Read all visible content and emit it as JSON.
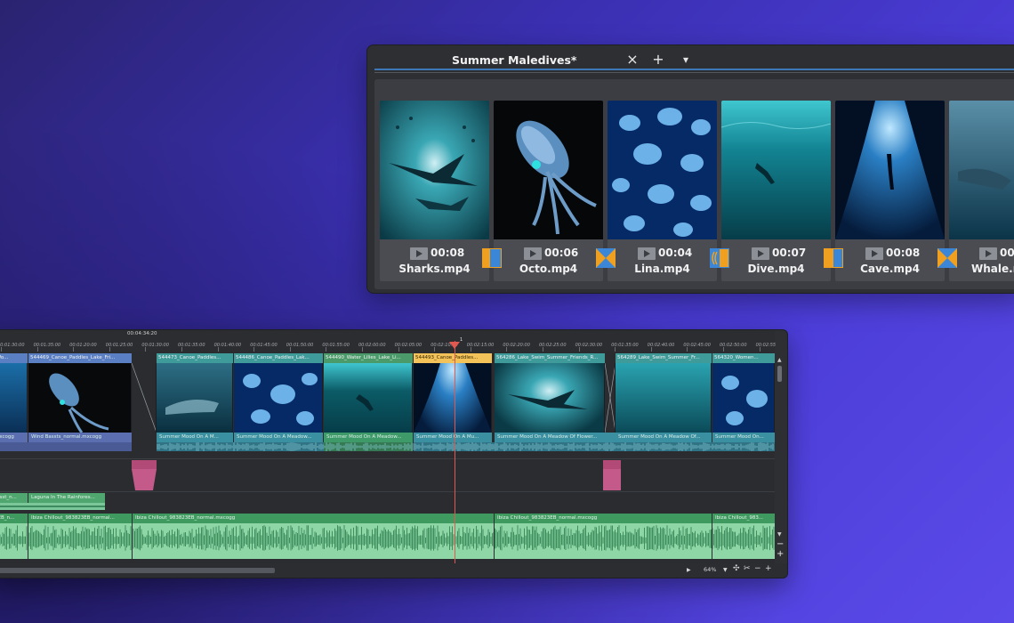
{
  "project": {
    "tab_title": "Summer Maledives*"
  },
  "bin_toolbar": {
    "close_icon": "×",
    "add_icon": "+",
    "menu_icon": "▾"
  },
  "bin_clips": [
    {
      "duration": "00:08",
      "name": "Sharks.mp4"
    },
    {
      "duration": "00:06",
      "name": "Octo.mp4"
    },
    {
      "duration": "00:04",
      "name": "Lina.mp4"
    },
    {
      "duration": "00:07",
      "name": "Dive.mp4"
    },
    {
      "duration": "00:08",
      "name": "Cave.mp4"
    },
    {
      "duration": "00",
      "name": "Whale.m"
    }
  ],
  "timeline": {
    "timecode_top": "00:04:34:20",
    "ruler_labels": [
      "00:01:30:00",
      "00:01:35:00",
      "00:01:20:00",
      "00:01:25:00",
      "00:01:30:00",
      "00:01:35:00",
      "00:01:40:00",
      "00:01:45:00",
      "00:01:50:00",
      "00:01:55:00",
      "00:02:00:00",
      "00:02:05:00",
      "00:02:10:00",
      "00:02:15:00",
      "00:02:20:00",
      "00:02:25:00",
      "00:02:30:00",
      "00:01:35:00",
      "00:02:40:00",
      "00:02:45:00",
      "00:02:50:00",
      "00:02:55"
    ],
    "video_clips": [
      {
        "title": "_Wo..."
      },
      {
        "title": "544469_Canoe_Paddles_Lake_Fri..."
      },
      {
        "title": "544473_Canoe_Paddles..."
      },
      {
        "title": "544486_Canoe_Paddles_Lak..."
      },
      {
        "title": "544490_Water_Lilies_Lake_Li..."
      },
      {
        "title": "544493_Canoe_Paddles..."
      },
      {
        "title": "564286_Lake_Swim_Summer_Friends_R..."
      },
      {
        "title": "564289_Lake_Swim_Summer_Fr..."
      },
      {
        "title": "564320_Women..."
      }
    ],
    "audio_clips": [
      {
        "label": "mxcogg"
      },
      {
        "label": "Wind Bassts_normal.mxcogg"
      },
      {
        "label": "Summer Mood On A M..."
      },
      {
        "label": "Summer Mood On A Meadow..."
      },
      {
        "label": "Summer Mood On A Meadow..."
      },
      {
        "label": "Summer Mood On A Mu..."
      },
      {
        "label": "Summer Mood On A Meadow Of Flower..."
      },
      {
        "label": "Summer Mood On A Meadow Of..."
      },
      {
        "label": "Summer Mood On..."
      }
    ],
    "music_short": [
      {
        "label": "resst_n..."
      },
      {
        "label": "Laguna In The Rainfores..."
      }
    ],
    "music_long": [
      {
        "label": "3EB_n..."
      },
      {
        "label": "Ibiza Chillout_983823EB_normal..."
      },
      {
        "label": "Ibiza Chillout_983823EB_normal.mxcogg"
      },
      {
        "label": "Ibiza Chillout_983823EB_normal.mxcogg"
      },
      {
        "label": "Ibiza Chillout_983..."
      }
    ],
    "zoom": "64%",
    "playhead_marker": "1"
  },
  "colors": {
    "tab_underline": "#3c78b8",
    "video_header_blue": "#5a7fc2",
    "video_header_green": "#4a9a6a",
    "video_header_selected": "#f3c35a",
    "audio_teal": "#3a8fa0",
    "music_green": "#4fa66e",
    "marker_pink": "#b24a78",
    "playhead": "#e0584f",
    "transition_orange": "#f0a020",
    "transition_blue": "#3b86d6"
  }
}
